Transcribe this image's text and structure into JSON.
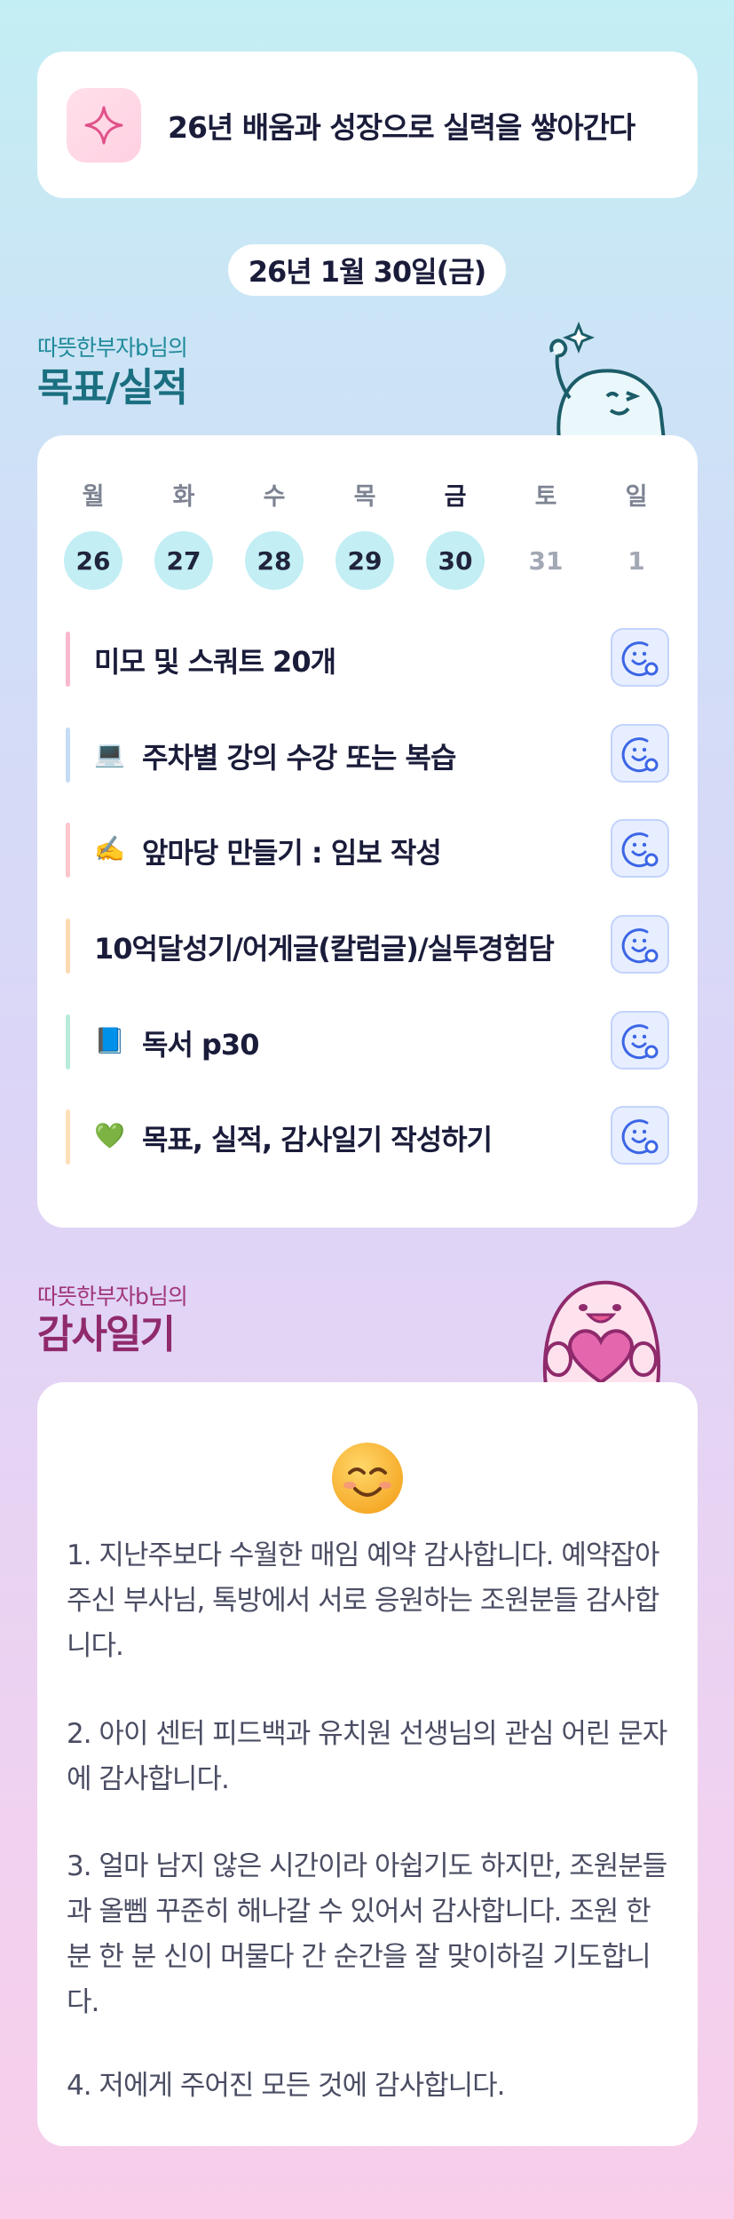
{
  "motto": {
    "text": "26년 배움과 성장으로 실력을 쌓아간다",
    "icon": "sparkle-icon"
  },
  "date": {
    "label": "26년 1월 30일(금)"
  },
  "goals_section": {
    "subtitle": "따뜻한부자b님의",
    "title": "목표/실적"
  },
  "week": [
    {
      "label": "월",
      "day": "26",
      "active": true
    },
    {
      "label": "화",
      "day": "27",
      "active": true
    },
    {
      "label": "수",
      "day": "28",
      "active": true
    },
    {
      "label": "목",
      "day": "29",
      "active": true
    },
    {
      "label": "금",
      "day": "30",
      "active": true
    },
    {
      "label": "토",
      "day": "31",
      "active": false
    },
    {
      "label": "일",
      "day": "1",
      "active": false
    }
  ],
  "goals": [
    {
      "emoji": "",
      "text": "미모 및 스쿼트 20개",
      "color": "#f9b8d0"
    },
    {
      "emoji": "💻",
      "text": "주차별 강의 수강 또는 복습",
      "color": "#c5dcf6"
    },
    {
      "emoji": "✍️",
      "text": "앞마당 만들기 : 임보 작성",
      "color": "#fbc6cc"
    },
    {
      "emoji": "",
      "text": "10억달성기/어게글(칼럼글)/실투경험담",
      "color": "#fdd9b2"
    },
    {
      "emoji": "📘",
      "text": "독서 p30",
      "color": "#b7ecd9"
    },
    {
      "emoji": "💚",
      "text": "목표, 실적, 감사일기 작성하기",
      "color": "#fde0b8"
    }
  ],
  "gratitude_section": {
    "subtitle": "따뜻한부자b님의",
    "title": "감사일기"
  },
  "gratitude": {
    "emoji": "😊",
    "paragraphs": [
      "1. 지난주보다 수월한 매임 예약 감사합니다. 예약잡아주신 부사님, 톡방에서 서로 응원하는 조원분들 감사합니다.",
      "2. 아이 센터 피드백과 유치원 선생님의 관심 어린 문자에 감사합니다.",
      "3. 얼마 남지 않은 시간이라 아쉽기도 하지만, 조원분들과 올뻼 꾸준히 해나갈 수 있어서 감사합니다. 조원 한 분 한 분 신이 머물다 간 순간을 잘 맞이하길 기도합니다.",
      "4. 저에게 주어진 모든 것에 감사합니다."
    ]
  },
  "colors": {
    "accent_teal": "#1a6f80",
    "accent_magenta": "#8f2a6c",
    "active_day": "#c2eef4",
    "goal_button": "#e7eeff"
  }
}
